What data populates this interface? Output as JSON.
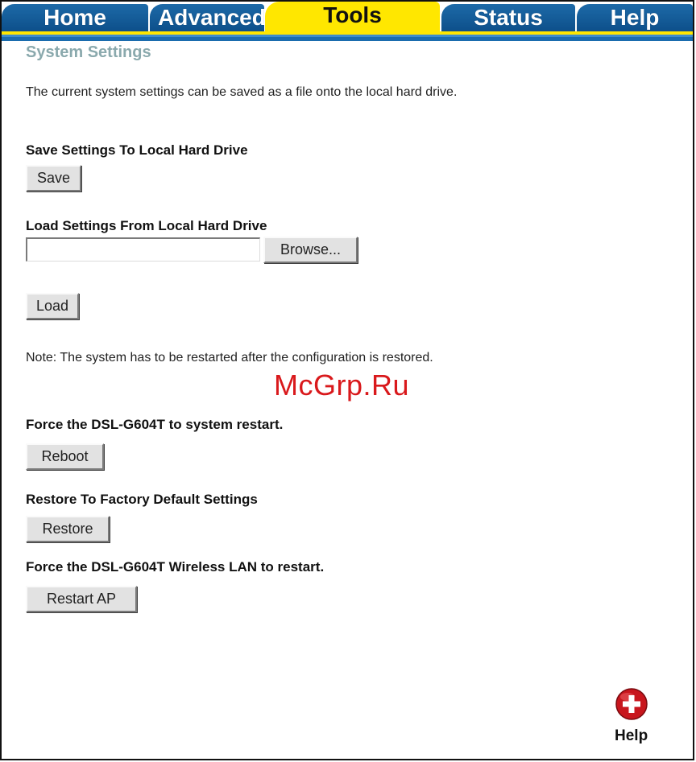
{
  "tabs": {
    "home": "Home",
    "advanced": "Advanced",
    "tools": "Tools",
    "status": "Status",
    "help": "Help",
    "active": "Tools"
  },
  "colors": {
    "tab_blue": "#1a6cae",
    "tab_active": "#ffe700",
    "title": "#8aa9ad",
    "watermark": "#d9191c"
  },
  "page": {
    "title": "System Settings",
    "intro": "The current system settings can be saved as a file onto the local hard drive."
  },
  "save_section": {
    "heading": "Save Settings To Local Hard Drive",
    "button": "Save"
  },
  "load_section": {
    "heading": "Load Settings From Local Hard Drive",
    "file_value": "",
    "browse_button": "Browse...",
    "load_button": "Load"
  },
  "note": "Note: The system has to be restarted after the configuration is restored.",
  "reboot_section": {
    "heading": "Force the DSL-G604T to system restart.",
    "button": "Reboot"
  },
  "restore_section": {
    "heading": "Restore To Factory Default Settings",
    "button": "Restore"
  },
  "restart_ap_section": {
    "heading": "Force the DSL-G604T Wireless LAN to restart.",
    "button": "Restart AP"
  },
  "watermark": "McGrp.Ru",
  "help": {
    "icon": "help-plus-icon",
    "label": "Help"
  }
}
